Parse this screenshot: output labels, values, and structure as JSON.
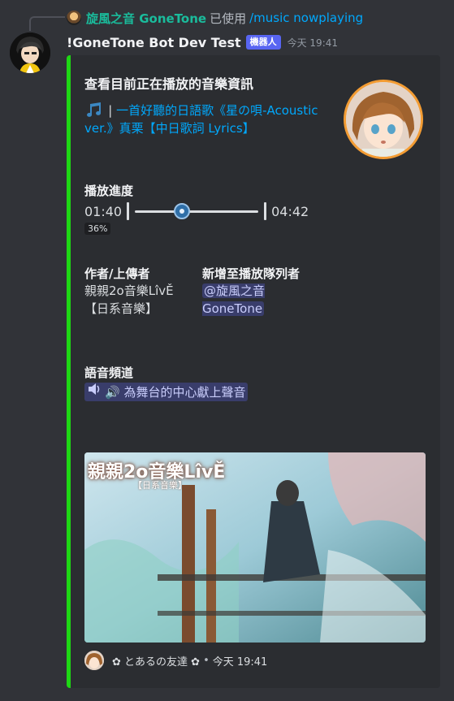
{
  "reply": {
    "username": "旋風之音 GoneTone",
    "used_text": "已使用",
    "command": "/music nowplaying"
  },
  "message": {
    "username": "!GoneTone Bot Dev Test",
    "badge": "機器人",
    "timestamp": "今天 19:41"
  },
  "embed": {
    "accent_color": "#1ed814",
    "title": "查看目前正在播放的音樂資訊",
    "description_icon": "music-notes-icon",
    "description_prefix": "| ",
    "description_link": "一首好聽的日語歌《星の唄-Acoustic ver.》真栗【中日歌詞 Lyrics】",
    "progress": {
      "label": "播放進度",
      "current": "01:40",
      "total": "04:42",
      "percent_text": "36%",
      "fraction": 0.36
    },
    "author": {
      "label": "作者/上傳者",
      "value": "親親2o音樂LîvĚ【日系音樂】"
    },
    "queued_by": {
      "label": "新增至播放隊列者",
      "value": "@旋風之音 GoneTone"
    },
    "voice_channel": {
      "label": "語音頻道",
      "value": "🔊 為舞台的中心獻上聲音"
    },
    "image": {
      "overlay_title": "親親2o音樂LîvĚ",
      "overlay_subtitle": "【日系音樂】"
    },
    "footer": {
      "text": "✿ とあるの友達 ✿",
      "separator": "•",
      "timestamp": "今天 19:41"
    }
  }
}
